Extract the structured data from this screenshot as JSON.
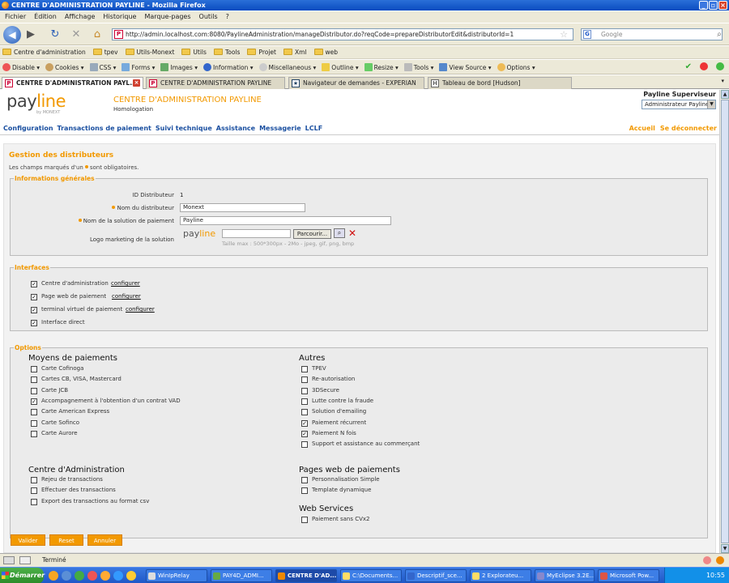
{
  "window": {
    "title": "CENTRE D'ADMINISTRATION PAYLINE - Mozilla Firefox"
  },
  "menu": [
    "Fichier",
    "Édition",
    "Affichage",
    "Historique",
    "Marque-pages",
    "Outils",
    "?"
  ],
  "url": "http://admin.localhost.com:8080/PaylineAdministration/manageDistributor.do?reqCode=prepareDistributorEdit&distributorId=1",
  "search_placeholder": "Google",
  "bookmarks": [
    "Centre d'administration",
    "tpev",
    "Utils-Monext",
    "Utils",
    "Tools",
    "Projet",
    "Xml",
    "web"
  ],
  "devtools": [
    "Disable",
    "Cookies",
    "CSS",
    "Forms",
    "Images",
    "Information",
    "Miscellaneous",
    "Outline",
    "Resize",
    "Tools",
    "View Source",
    "Options"
  ],
  "tabs": [
    "CENTRE D'ADMINISTRATION PAYL...",
    "CENTRE D'ADMINISTRATION PAYLINE",
    "Navigateur de demandes - EXPERIAN",
    "Tableau de bord [Hudson]"
  ],
  "header": {
    "logo_text": "pay",
    "logo_accent": "line",
    "by": "by MONEXT",
    "app_title": "CENTRE D'ADMINISTRATION PAYLINE",
    "app_sub": "Homologation",
    "user_role": "Payline Superviseur",
    "role_select": "Administrateur Payline"
  },
  "nav": [
    "Configuration",
    "Transactions de paiement",
    "Suivi technique",
    "Assistance",
    "Messagerie",
    "LCLF"
  ],
  "nav_right": [
    "Accueil",
    "Se déconnecter"
  ],
  "page_title": "Gestion des distributeurs",
  "required_note_pre": "Les champs marqués d'un",
  "required_note_post": "sont obligatoires.",
  "general": {
    "legend": "Informations générales",
    "id_label": "ID Distributeur",
    "id_value": "1",
    "name_label": "Nom du distributeur",
    "name_value": "Monext",
    "solution_label": "Nom de la solution de paiement",
    "solution_value": "Payline",
    "logo_label": "Logo marketing de la solution",
    "logo_pay": "pay",
    "logo_line": "line",
    "browse": "Parcourir...",
    "hint": "Taille max : 500*300px - 2Mo - jpeg, gif, png, bmp"
  },
  "interfaces": {
    "legend": "Interfaces",
    "items": [
      {
        "label": "Centre d'administration",
        "link": "configurer",
        "checked": true
      },
      {
        "label": "Page web de paiement",
        "link": "configurer",
        "checked": true
      },
      {
        "label": "terminal virtuel de paiement",
        "link": "configurer",
        "checked": true
      },
      {
        "label": "Interface direct",
        "link": "",
        "checked": true
      }
    ]
  },
  "options": {
    "legend": "Options",
    "moyens_title": "Moyens de paiements",
    "moyens": [
      {
        "label": "Carte Cofinoga",
        "checked": false
      },
      {
        "label": "Cartes CB, VISA, Mastercard",
        "checked": false
      },
      {
        "label": "Carte JCB",
        "checked": false
      },
      {
        "label": "Accompagnement à l'obtention d'un contrat VAD",
        "checked": true
      },
      {
        "label": "Carte American Express",
        "checked": false
      },
      {
        "label": "Carte Sofinco",
        "checked": false
      },
      {
        "label": "Carte Aurore",
        "checked": false
      }
    ],
    "autres_title": "Autres",
    "autres": [
      {
        "label": "TPEV",
        "checked": false
      },
      {
        "label": "Re-autorisation",
        "checked": false
      },
      {
        "label": "3DSecure",
        "checked": false
      },
      {
        "label": "Lutte contre la fraude",
        "checked": false
      },
      {
        "label": "Solution d'emailing",
        "checked": false
      },
      {
        "label": "Paiement récurrent",
        "checked": true
      },
      {
        "label": "Paiement N fois",
        "checked": true
      },
      {
        "label": "Support et assistance au commerçant",
        "checked": false
      }
    ],
    "centre_title": "Centre d'Administration",
    "centre": [
      {
        "label": "Rejeu de transactions",
        "checked": false
      },
      {
        "label": "Effectuer des transactions",
        "checked": false
      },
      {
        "label": "Export des transactions au format csv",
        "checked": false
      }
    ],
    "pages_title": "Pages web de paiements",
    "pages": [
      {
        "label": "Personnalisation Simple",
        "checked": false
      },
      {
        "label": "Template dynamique",
        "checked": false
      }
    ],
    "ws_title": "Web Services",
    "ws": [
      {
        "label": "Paiement sans CVx2",
        "checked": false
      }
    ]
  },
  "buttons": {
    "validate": "Valider",
    "reset": "Reset",
    "cancel": "Annuler"
  },
  "status": "Terminé",
  "taskbar": {
    "start": "Démarrer",
    "items": [
      "WinIpRelay",
      "PAY4D_ADMI...",
      "CENTRE D'AD...",
      "C:\\Documents...",
      "Descriptif_sce...",
      "2 Explorateu...",
      "MyEclipse 3.2E...",
      "Microsoft Pow..."
    ],
    "clock": "10:55"
  },
  "colors": {
    "accent": "#f29900",
    "nav_blue": "#1a4fa0"
  }
}
